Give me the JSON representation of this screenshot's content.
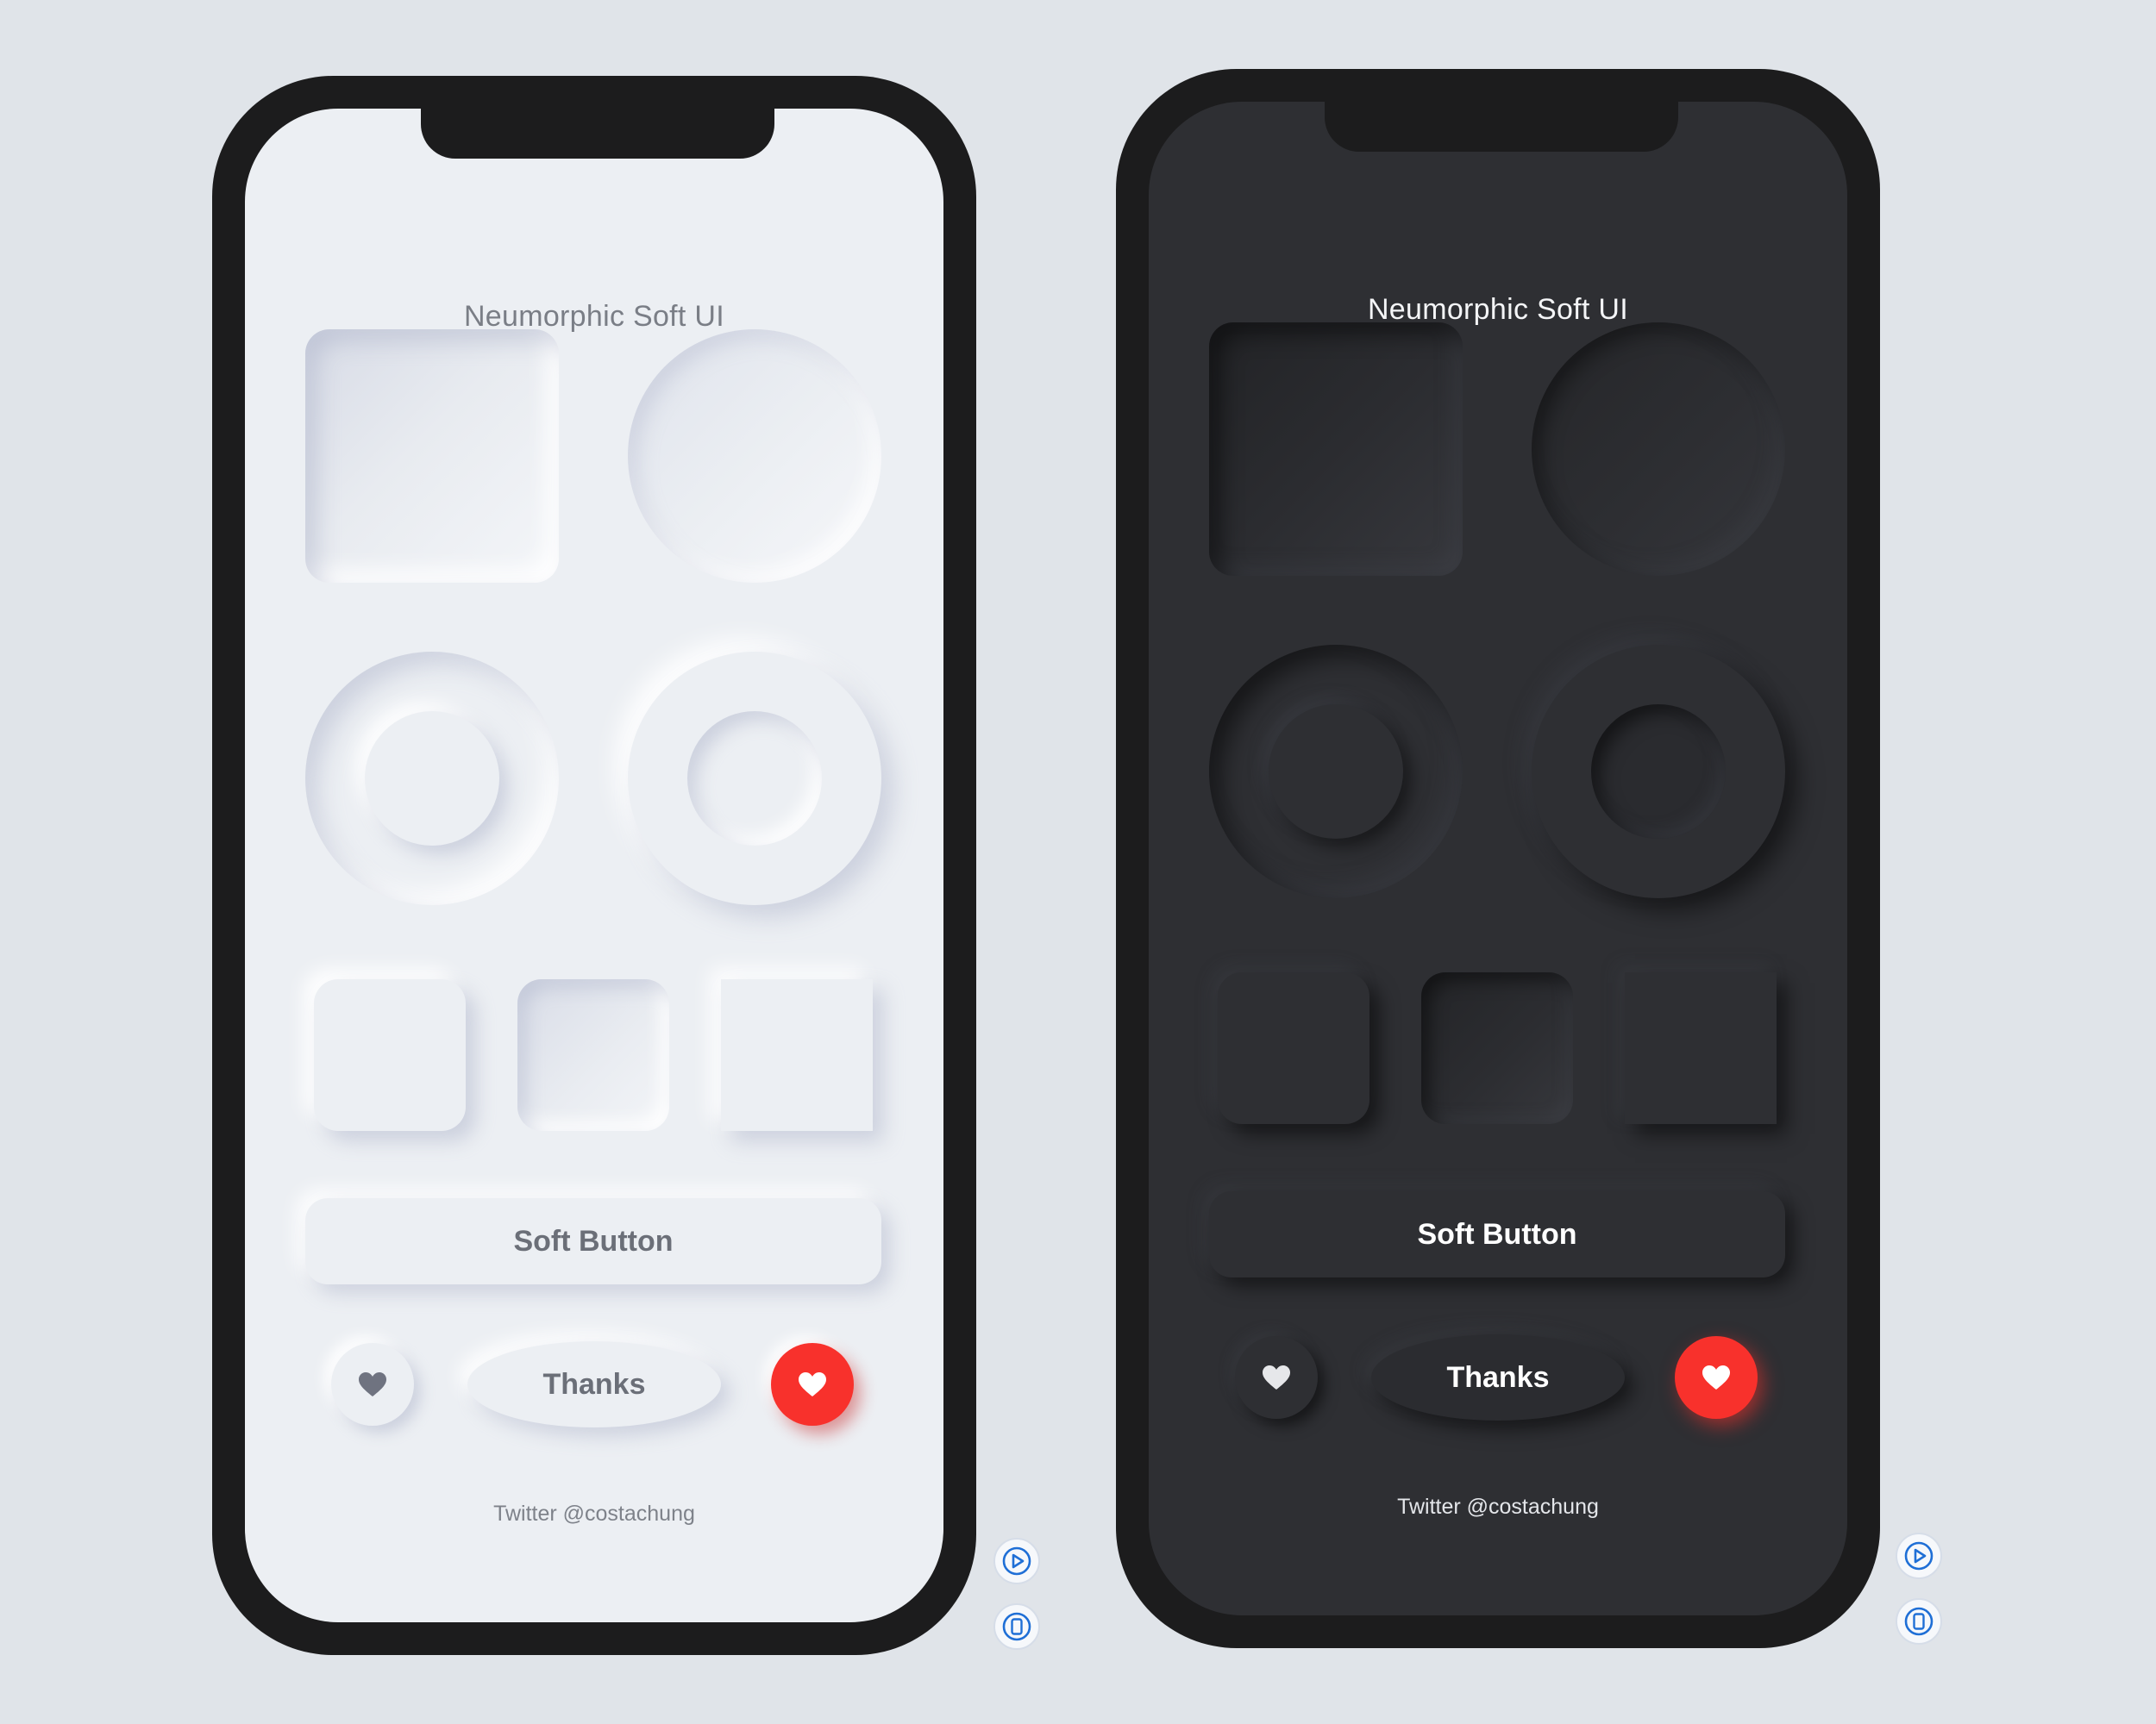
{
  "colors": {
    "page_background": "#e0e4e9",
    "phone_frame": "#1c1c1d",
    "light_surface": "#eceff3",
    "dark_surface": "#2e2f33",
    "accent_red": "#f8312c",
    "side_button_blue": "#1f6fd6"
  },
  "light_phone": {
    "title": "Neumorphic Soft UI",
    "soft_button_label": "Soft Button",
    "small_heart_icon": "heart-icon",
    "thanks_label": "Thanks",
    "red_heart_icon": "heart-icon",
    "credit": "Twitter @costachung"
  },
  "dark_phone": {
    "title": "Neumorphic Soft UI",
    "soft_button_label": "Soft Button",
    "small_heart_icon": "heart-icon",
    "thanks_label": "Thanks",
    "red_heart_icon": "heart-icon",
    "credit": "Twitter @costachung"
  },
  "side_controls": {
    "play_icon": "play-icon",
    "device_icon": "phone-device-icon"
  }
}
